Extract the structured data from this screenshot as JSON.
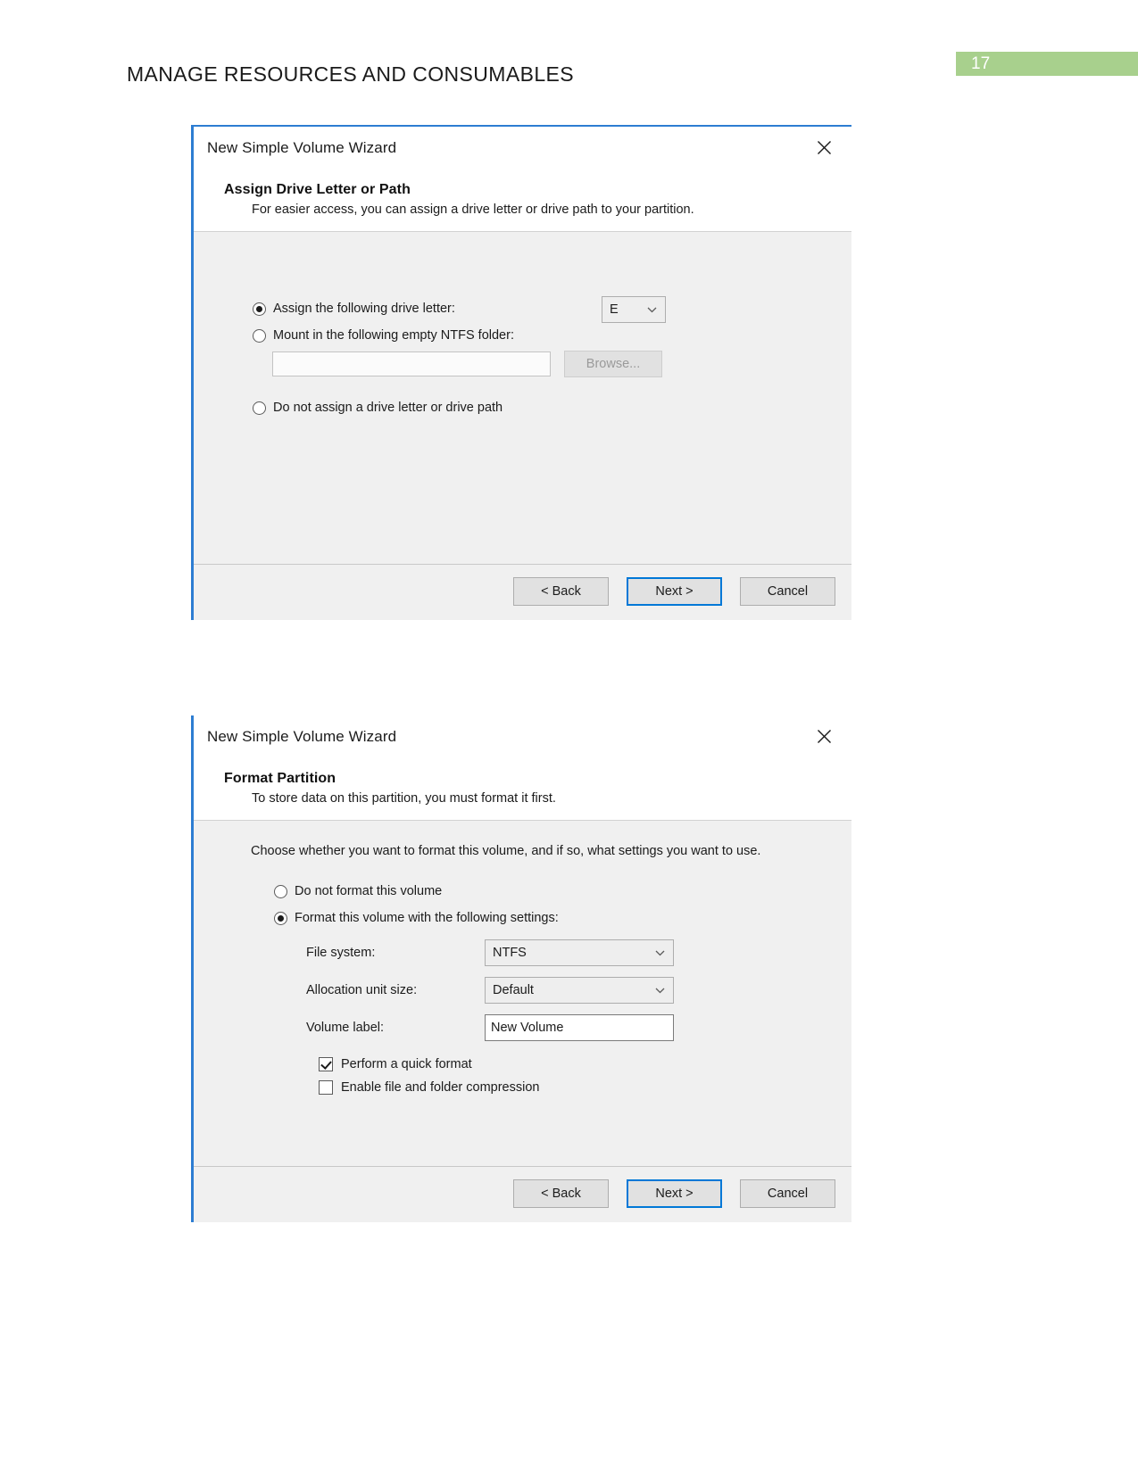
{
  "page": {
    "header_title": "MANAGE RESOURCES AND CONSUMABLES",
    "page_number": "17",
    "badge_color": "#a8d08d",
    "accent_color": "#0078d7"
  },
  "dialog_assign": {
    "window_title": "New Simple Volume Wizard",
    "close_icon": "close-icon",
    "heading": "Assign Drive Letter or Path",
    "description": "For easier access, you can assign a drive letter or drive path to your partition.",
    "options": [
      {
        "label": "Assign the following drive letter:",
        "checked": true
      },
      {
        "label": "Mount in the following empty NTFS folder:",
        "checked": false
      },
      {
        "label": "Do not assign a drive letter or drive path",
        "checked": false
      }
    ],
    "drive_letter": {
      "value": "E",
      "chevron_icon": "chevron-down-icon"
    },
    "mount_path": {
      "value": "",
      "placeholder": ""
    },
    "browse_label": "Browse...",
    "buttons": {
      "back": "< Back",
      "next": "Next >",
      "cancel": "Cancel"
    }
  },
  "dialog_format": {
    "window_title": "New Simple Volume Wizard",
    "close_icon": "close-icon",
    "heading": "Format Partition",
    "description": "To store data on this partition, you must format it first.",
    "intro": "Choose whether you want to format this volume, and if so, what settings you want to use.",
    "options": [
      {
        "label": "Do not format this volume",
        "checked": false
      },
      {
        "label": "Format this volume with the following settings:",
        "checked": true
      }
    ],
    "fields": [
      {
        "label": "File system:",
        "value": "NTFS",
        "type": "combo"
      },
      {
        "label": "Allocation unit size:",
        "value": "Default",
        "type": "combo"
      },
      {
        "label": "Volume label:",
        "value": "New Volume",
        "type": "text"
      }
    ],
    "chevron_icon": "chevron-down-icon",
    "checkboxes": [
      {
        "label": "Perform a quick format",
        "checked": true
      },
      {
        "label": "Enable file and folder compression",
        "checked": false
      }
    ],
    "buttons": {
      "back": "< Back",
      "next": "Next >",
      "cancel": "Cancel"
    }
  }
}
